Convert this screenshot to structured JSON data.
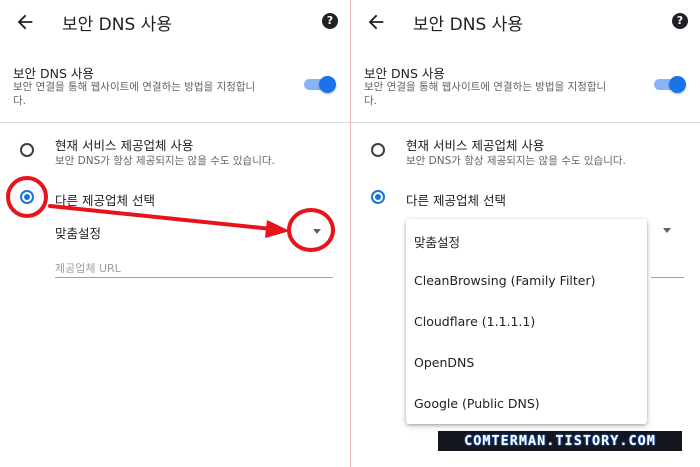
{
  "header": {
    "title": "보안 DNS 사용",
    "back_icon": "arrow-left-icon",
    "help_icon": "help-circle-icon",
    "help_glyph": "?"
  },
  "secure_dns": {
    "title": "보안 DNS 사용",
    "desc": "보안 연결을 통해 웹사이트에 연결하는 방법을 지정합니다.",
    "toggle_on": true,
    "accent": "#1a73e8"
  },
  "options": {
    "current": {
      "title": "현재 서비스 제공업체 사용",
      "desc": "보안 DNS가 항상 제공되지는 않을 수도 있습니다."
    },
    "other": {
      "title": "다른 제공업체 선택"
    }
  },
  "provider_select": {
    "selected": "맞춤설정",
    "url_placeholder": "제공업체 URL"
  },
  "dropdown_menu": {
    "items": [
      "맞춤설정",
      "CleanBrowsing (Family Filter)",
      "Cloudflare (1.1.1.1)",
      "OpenDNS",
      "Google (Public DNS)"
    ]
  },
  "annotation": {
    "color": "#e8141b"
  },
  "watermark": "COMTERMAN.TISTORY.COM"
}
